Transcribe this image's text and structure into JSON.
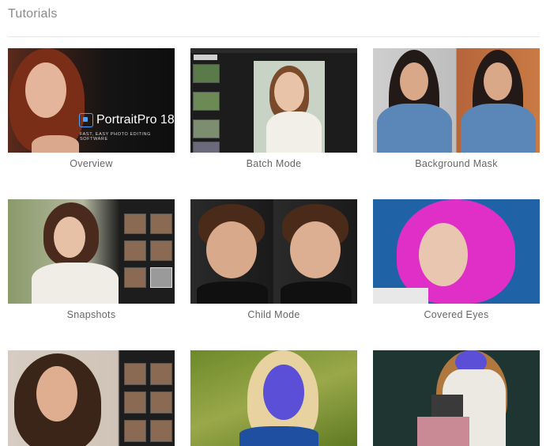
{
  "page": {
    "title": "Tutorials"
  },
  "tutorials": [
    {
      "label": "Overview",
      "logo_name": "PortraitPro 18",
      "tagline": "FAST, EASY PHOTO EDITING SOFTWARE"
    },
    {
      "label": "Batch Mode"
    },
    {
      "label": "Background Mask"
    },
    {
      "label": "Snapshots"
    },
    {
      "label": "Child Mode"
    },
    {
      "label": "Covered Eyes"
    },
    {
      "label": ""
    },
    {
      "label": ""
    },
    {
      "label": ""
    }
  ],
  "colors": {
    "title_text": "#8a8a8a",
    "caption_text": "#666666",
    "divider": "#e6e6e6",
    "pink_hair": "#e02fc7",
    "blue_face": "#5a4fd6",
    "bg_blue": "#1f63a6"
  }
}
